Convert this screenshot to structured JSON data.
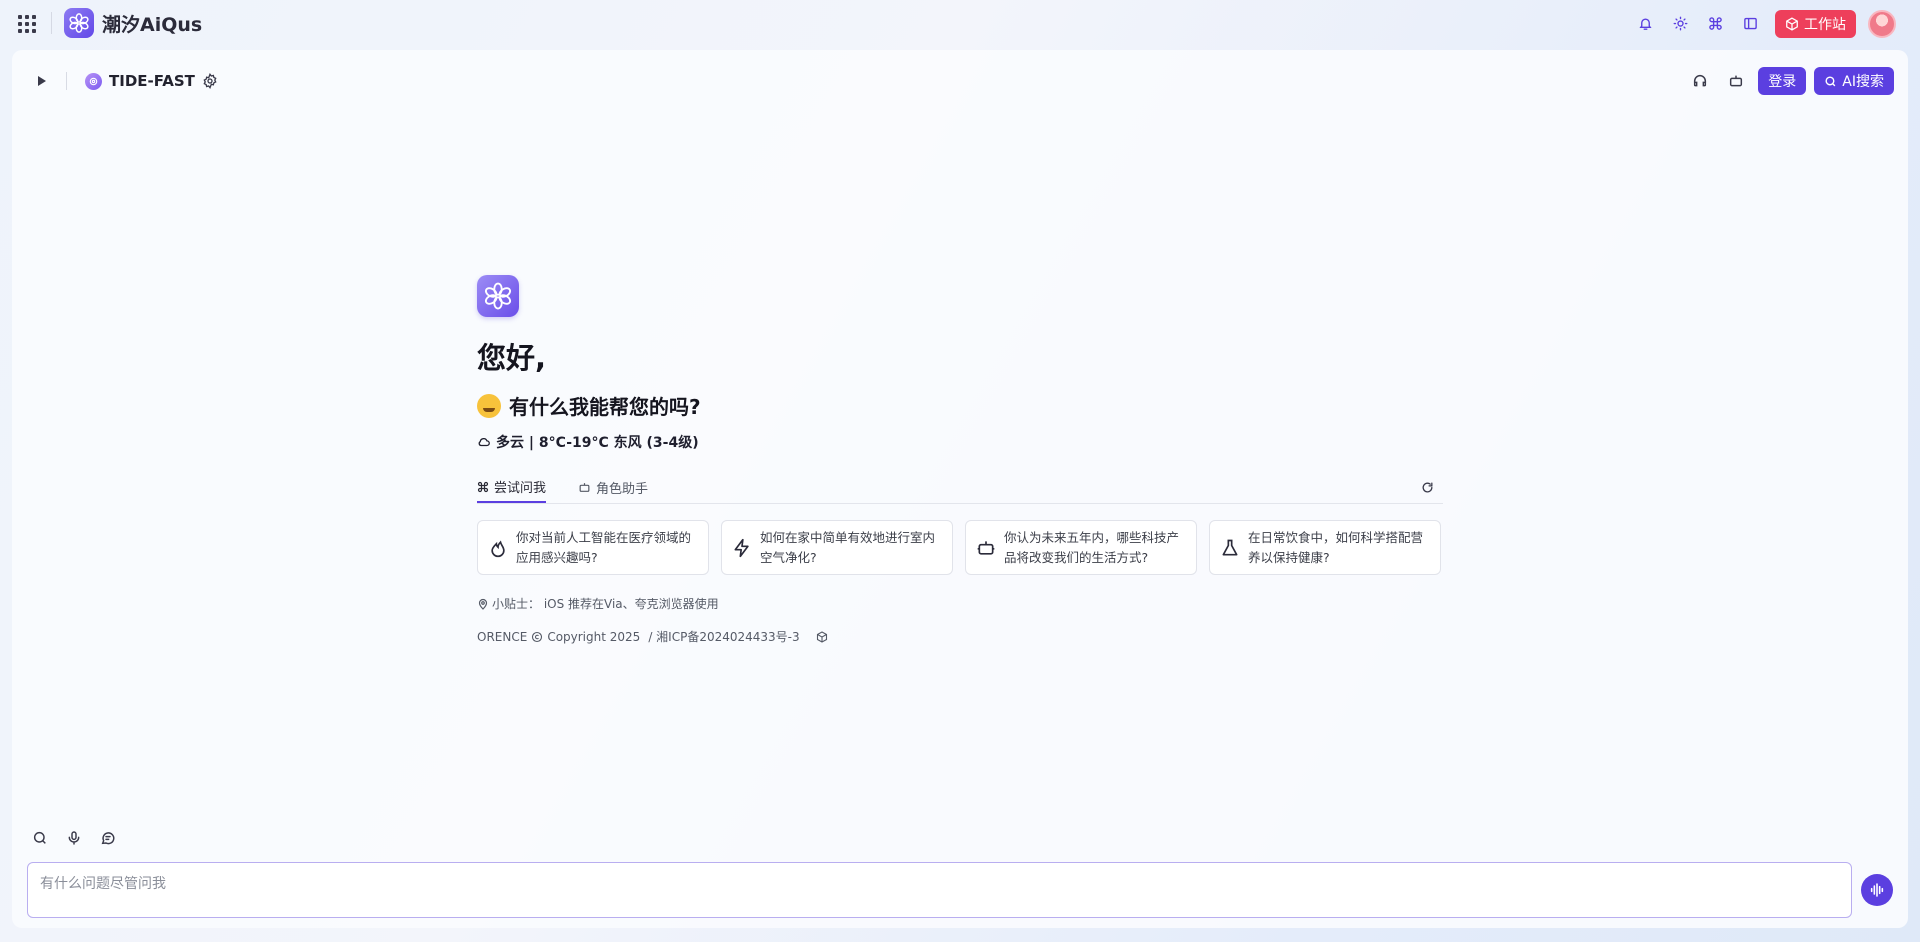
{
  "header": {
    "brand_name": "潮汐AiQus",
    "workstation_label": "工作站"
  },
  "subbar": {
    "model_name": "TIDE-FAST",
    "login_label": "登录",
    "ai_search_label": "AI搜索"
  },
  "hero": {
    "greeting": "您好,",
    "question": "有什么我能帮您的吗?",
    "weather": "多云 | 8°C-19°C 东风 (3-4级)"
  },
  "tabs": [
    {
      "label": "尝试问我",
      "active": true
    },
    {
      "label": "角色助手",
      "active": false
    }
  ],
  "suggestions": [
    {
      "icon": "flame-icon",
      "text": "你对当前人工智能在医疗领域的应用感兴趣吗?"
    },
    {
      "icon": "lightning-icon",
      "text": "如何在家中简单有效地进行室内空气净化?"
    },
    {
      "icon": "robot-icon",
      "text": "你认为未来五年内，哪些科技产品将改变我们的生活方式?"
    },
    {
      "icon": "flask-icon",
      "text": "在日常饮食中，如何科学搭配营养以保持健康?"
    }
  ],
  "tip": "小贴士：  iOS 推荐在Via、夸克浏览器使用",
  "footer": {
    "org": "ORENCE",
    "copyright": "Copyright 2025",
    "icp": "/ 湘ICP备2024024433号-3"
  },
  "input": {
    "placeholder": "有什么问题尽管问我"
  },
  "colors": {
    "accent": "#5b3fe0",
    "workstation": "#ee3f5b"
  }
}
